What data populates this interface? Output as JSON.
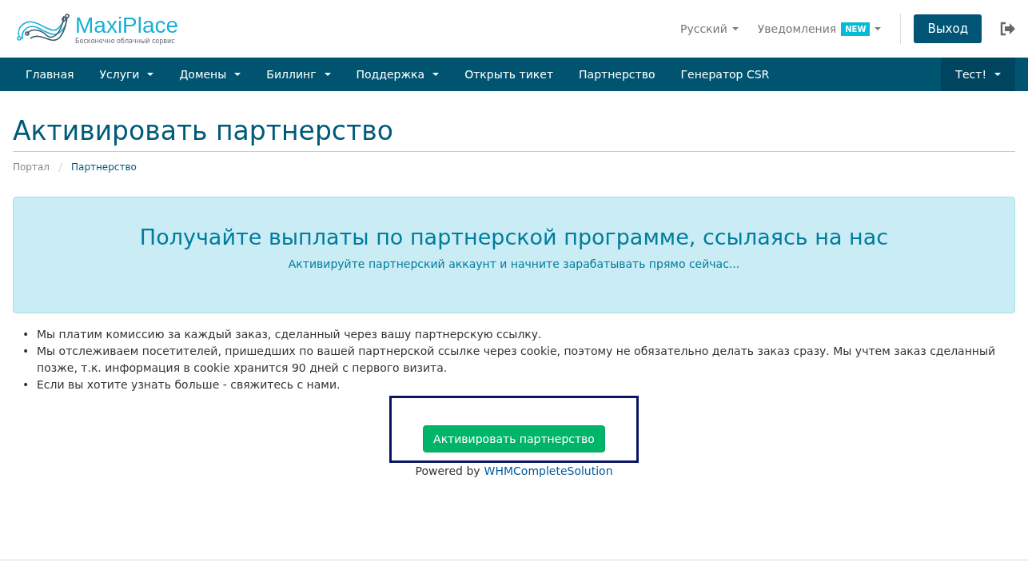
{
  "logo": {
    "name": "MaxiPlace",
    "tagline": "Бесконечно облачный сервис"
  },
  "top_links": [
    {
      "label": "Русский",
      "dropdown": true
    },
    {
      "label": "Уведомления",
      "badge": "NEW",
      "dropdown": true
    }
  ],
  "logout_button": "Выход",
  "nav": [
    {
      "label": "Главная",
      "dropdown": false
    },
    {
      "label": "Услуги",
      "dropdown": true
    },
    {
      "label": "Домены",
      "dropdown": true
    },
    {
      "label": "Биллинг",
      "dropdown": true
    },
    {
      "label": "Поддержка",
      "dropdown": true
    },
    {
      "label": "Открыть тикет",
      "dropdown": false
    },
    {
      "label": "Партнерство",
      "dropdown": false
    },
    {
      "label": "Генератор CSR",
      "dropdown": false
    }
  ],
  "user_menu": {
    "label": "Тест!",
    "dropdown": true
  },
  "page_title": "Активировать партнерство",
  "breadcrumb": [
    {
      "label": "Портал",
      "selected": false
    },
    {
      "label": "Партнерство",
      "selected": true
    }
  ],
  "banner": {
    "title": "Получайте выплаты по партнерской программе, ссылаясь на нас",
    "subtitle": "Активируйте партнерский аккаунт и начните зарабатывать прямо сейчас..."
  },
  "bullets": [
    {
      "marker": "•",
      "text": "Мы платим комиссию за каждый заказ, сделанный через вашу партнерскую ссылку."
    },
    {
      "marker": "•",
      "text": "Мы отслеживаем посетителей, пришедших по вашей партнерской ссылке через cookie, поэтому не обязательно делать заказ сразу. Мы учтем заказ сделанный позже, т.к. информация в cookie хранится 90 дней с первого визита."
    },
    {
      "marker": "•",
      "text": "Если вы хотите узнать больше - свяжитесь с нами."
    }
  ],
  "activate_button": "Активировать партнерство",
  "footer": {
    "prefix": "Powered by",
    "link": "WHMCompleteSolution"
  }
}
